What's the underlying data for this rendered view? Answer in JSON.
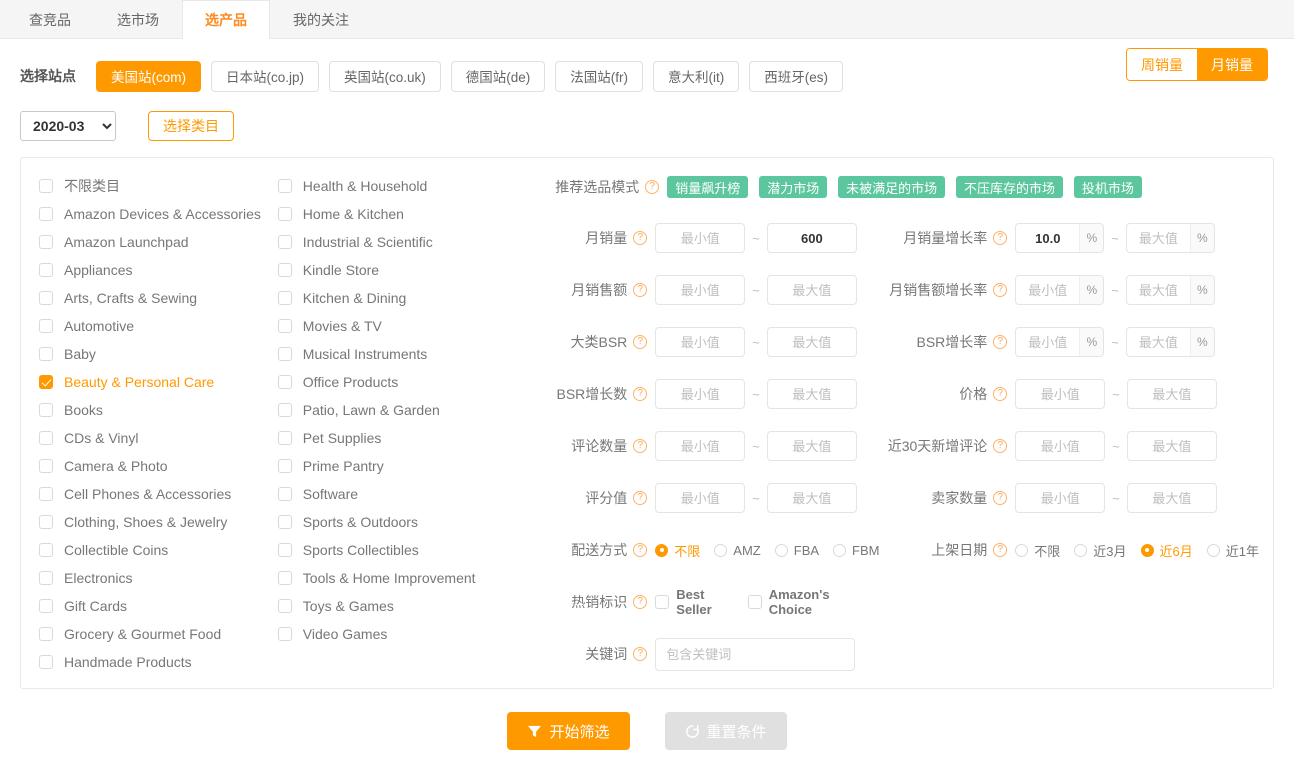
{
  "tabs": [
    {
      "label": "查竞品",
      "active": false
    },
    {
      "label": "选市场",
      "active": false
    },
    {
      "label": "选产品",
      "active": true
    },
    {
      "label": "我的关注",
      "active": false
    }
  ],
  "site": {
    "label": "选择站点",
    "buttons": [
      {
        "label": "美国站(com)",
        "active": true
      },
      {
        "label": "日本站(co.jp)",
        "active": false
      },
      {
        "label": "英国站(co.uk)",
        "active": false
      },
      {
        "label": "德国站(de)",
        "active": false
      },
      {
        "label": "法国站(fr)",
        "active": false
      },
      {
        "label": "意大利(it)",
        "active": false
      },
      {
        "label": "西班牙(es)",
        "active": false
      }
    ]
  },
  "sales_toggle": {
    "week": "周销量",
    "month": "月销量",
    "selected": "月销量"
  },
  "date_row": {
    "month_value": "2020-03",
    "month_options": [
      "2020-03"
    ],
    "category_button": "选择类目"
  },
  "categories": {
    "col1": [
      {
        "label": "不限类目",
        "checked": false
      },
      {
        "label": "Amazon Devices & Accessories",
        "checked": false
      },
      {
        "label": "Amazon Launchpad",
        "checked": false
      },
      {
        "label": "Appliances",
        "checked": false
      },
      {
        "label": "Arts, Crafts & Sewing",
        "checked": false
      },
      {
        "label": "Automotive",
        "checked": false
      },
      {
        "label": "Baby",
        "checked": false
      },
      {
        "label": "Beauty & Personal Care",
        "checked": true
      },
      {
        "label": "Books",
        "checked": false
      },
      {
        "label": "CDs & Vinyl",
        "checked": false
      },
      {
        "label": "Camera & Photo",
        "checked": false
      },
      {
        "label": "Cell Phones & Accessories",
        "checked": false
      },
      {
        "label": "Clothing, Shoes & Jewelry",
        "checked": false
      },
      {
        "label": "Collectible Coins",
        "checked": false
      },
      {
        "label": "Electronics",
        "checked": false
      },
      {
        "label": "Gift Cards",
        "checked": false
      },
      {
        "label": "Grocery & Gourmet Food",
        "checked": false
      },
      {
        "label": "Handmade Products",
        "checked": false
      }
    ],
    "col2": [
      {
        "label": "Health & Household",
        "checked": false
      },
      {
        "label": "Home & Kitchen",
        "checked": false
      },
      {
        "label": "Industrial & Scientific",
        "checked": false
      },
      {
        "label": "Kindle Store",
        "checked": false
      },
      {
        "label": "Kitchen & Dining",
        "checked": false
      },
      {
        "label": "Movies & TV",
        "checked": false
      },
      {
        "label": "Musical Instruments",
        "checked": false
      },
      {
        "label": "Office Products",
        "checked": false
      },
      {
        "label": "Patio, Lawn & Garden",
        "checked": false
      },
      {
        "label": "Pet Supplies",
        "checked": false
      },
      {
        "label": "Prime Pantry",
        "checked": false
      },
      {
        "label": "Software",
        "checked": false
      },
      {
        "label": "Sports & Outdoors",
        "checked": false
      },
      {
        "label": "Sports Collectibles",
        "checked": false
      },
      {
        "label": "Tools & Home Improvement",
        "checked": false
      },
      {
        "label": "Toys & Games",
        "checked": false
      },
      {
        "label": "Video Games",
        "checked": false
      }
    ]
  },
  "filters": {
    "mode": {
      "label": "推荐选品模式",
      "tags": [
        "销量飙升榜",
        "潜力市场",
        "未被满足的市场",
        "不压库存的市场",
        "投机市场"
      ]
    },
    "placeholders": {
      "min": "最小值",
      "max": "最大值"
    },
    "tilde": "~",
    "percent": "%",
    "rows": [
      {
        "left_label": "月销量",
        "left_min": "",
        "left_max": "600",
        "right_label": "月销量增长率",
        "right_min": "10.0",
        "right_max": "",
        "right_pct": true
      },
      {
        "left_label": "月销售额",
        "left_min": "",
        "left_max": "",
        "right_label": "月销售额增长率",
        "right_min": "",
        "right_max": "",
        "right_pct": true
      },
      {
        "left_label": "大类BSR",
        "left_min": "",
        "left_max": "",
        "right_label": "BSR增长率",
        "right_min": "",
        "right_max": "",
        "right_pct": true
      },
      {
        "left_label": "BSR增长数",
        "left_min": "",
        "left_max": "",
        "right_label": "价格",
        "right_min": "",
        "right_max": "",
        "right_pct": false
      },
      {
        "left_label": "评论数量",
        "left_min": "",
        "left_max": "",
        "right_label": "近30天新增评论",
        "right_min": "",
        "right_max": "",
        "right_pct": false
      },
      {
        "left_label": "评分值",
        "left_min": "",
        "left_max": "",
        "right_label": "卖家数量",
        "right_min": "",
        "right_max": "",
        "right_pct": false
      }
    ],
    "shipping": {
      "label": "配送方式",
      "options": [
        {
          "label": "不限",
          "selected": true
        },
        {
          "label": "AMZ",
          "selected": false
        },
        {
          "label": "FBA",
          "selected": false
        },
        {
          "label": "FBM",
          "selected": false
        }
      ]
    },
    "listing_date": {
      "label": "上架日期",
      "options": [
        {
          "label": "不限",
          "selected": false
        },
        {
          "label": "近3月",
          "selected": false
        },
        {
          "label": "近6月",
          "selected": true
        },
        {
          "label": "近1年",
          "selected": false
        }
      ]
    },
    "hot_flag": {
      "label": "热销标识",
      "options": [
        {
          "label": "Best Seller",
          "checked": false
        },
        {
          "label": "Amazon's Choice",
          "checked": false
        }
      ]
    },
    "keyword": {
      "label": "关键词",
      "placeholder": "包含关键词",
      "value": ""
    }
  },
  "actions": {
    "submit": "开始筛选",
    "reset": "重置条件"
  },
  "colors": {
    "accent": "#ff9900",
    "tag_green": "#5cc79e",
    "muted": "#777777"
  }
}
